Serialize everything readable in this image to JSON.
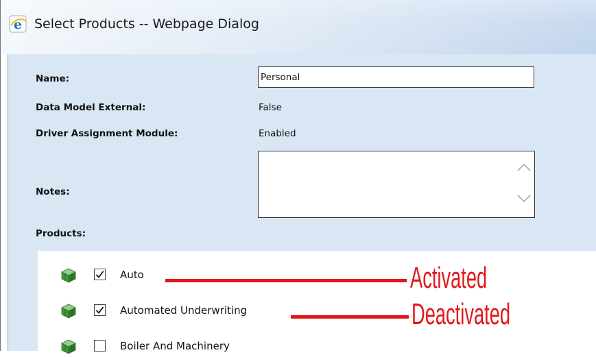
{
  "window": {
    "title": "Select Products -- Webpage Dialog",
    "icon": "ie-icon"
  },
  "form": {
    "name_label": "Name:",
    "name_value": "Personal",
    "data_model_label": "Data Model External:",
    "data_model_value": "False",
    "driver_label": "Driver Assignment Module:",
    "driver_value": "Enabled",
    "notes_label": "Notes:",
    "notes_value": "",
    "products_label": "Products:"
  },
  "products": [
    {
      "label": "Auto",
      "checked": true,
      "icon": "product-cube-icon"
    },
    {
      "label": "Automated Underwriting",
      "checked": true,
      "icon": "product-cube-icon"
    },
    {
      "label": "Boiler And Machinery",
      "checked": false,
      "icon": "product-cube-icon"
    }
  ],
  "annotations": {
    "activated": "Activated",
    "deactivated": "Deactivated",
    "color": "#e3171b"
  }
}
